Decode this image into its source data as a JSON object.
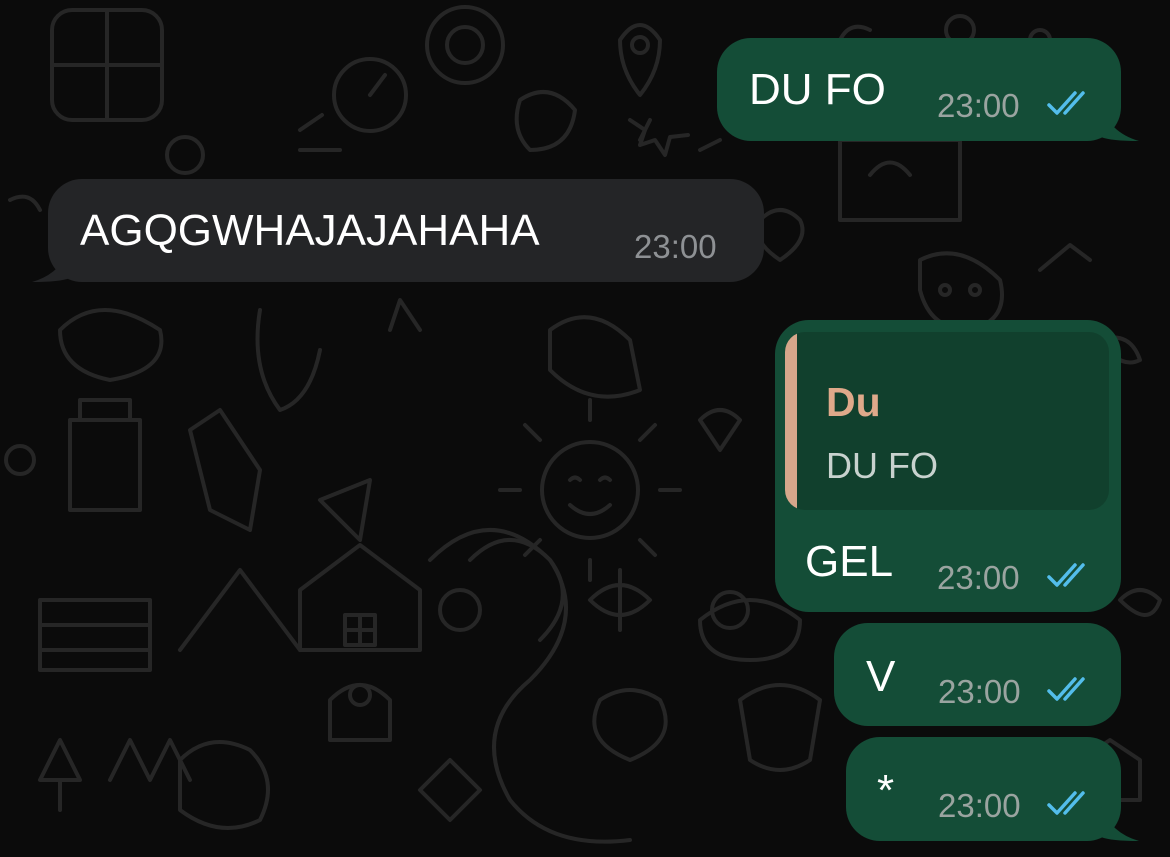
{
  "colors": {
    "outgoing_bubble": "#144d37",
    "incoming_bubble": "#242527",
    "quote_background": "#11402d",
    "quote_accent": "#d6a78b",
    "read_ticks": "#53bdeb",
    "background": "#0b0b0b"
  },
  "messages": [
    {
      "direction": "outgoing",
      "text": "DU FO",
      "time": "23:00",
      "status": "read",
      "status_icon": "double-check-icon"
    },
    {
      "direction": "incoming",
      "text": "AGQGWHAJAJAHAHA",
      "time": "23:00"
    },
    {
      "direction": "outgoing",
      "text": "GEL",
      "time": "23:00",
      "status": "read",
      "status_icon": "double-check-icon",
      "quote": {
        "author": "Du",
        "text": "DU FO"
      }
    },
    {
      "direction": "outgoing",
      "text": "V",
      "time": "23:00",
      "status": "read",
      "status_icon": "double-check-icon"
    },
    {
      "direction": "outgoing",
      "text": "*",
      "time": "23:00",
      "status": "read",
      "status_icon": "double-check-icon"
    }
  ]
}
